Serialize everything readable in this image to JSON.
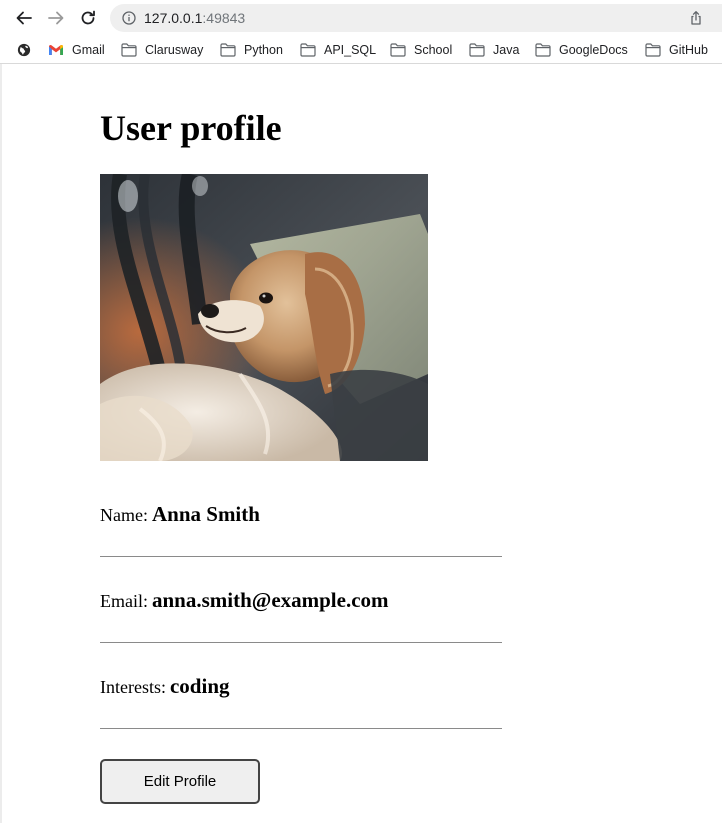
{
  "browser": {
    "url_host": "127.0.0.1",
    "url_port": ":49843",
    "bookmarks": [
      {
        "label": "",
        "icon": "globe-icon"
      },
      {
        "label": "Gmail",
        "icon": "gmail-icon"
      },
      {
        "label": "Clarusway",
        "icon": "folder-icon"
      },
      {
        "label": "Python",
        "icon": "folder-icon"
      },
      {
        "label": "API_SQL",
        "icon": "folder-icon"
      },
      {
        "label": "School",
        "icon": "folder-icon"
      },
      {
        "label": "Java",
        "icon": "folder-icon"
      },
      {
        "label": "GoogleDocs",
        "icon": "folder-icon"
      },
      {
        "label": "GitHub",
        "icon": "folder-icon"
      }
    ]
  },
  "page": {
    "title": "User profile",
    "photo_alt": "dog photo",
    "fields": {
      "name": {
        "label": "Name:",
        "value": "Anna Smith"
      },
      "email": {
        "label": "Email:",
        "value": "anna.smith@example.com"
      },
      "interests": {
        "label": "Interests:",
        "value": "coding"
      }
    },
    "edit_button": "Edit Profile"
  },
  "colors": {
    "omnibox": "#efefef",
    "divider": "#8a8a8a",
    "button_bg": "#efefef",
    "button_border": "#444444"
  }
}
